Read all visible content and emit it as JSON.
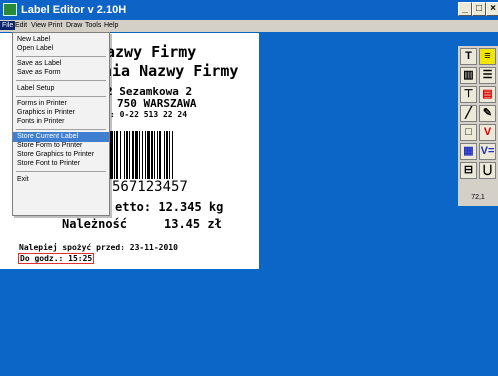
{
  "window": {
    "title": "Label Editor v 2.10H",
    "min": "_",
    "max": "□",
    "close": "×"
  },
  "menubar": [
    "File",
    "Edit",
    "View",
    "Print",
    "Draw",
    "Tools",
    "Help"
  ],
  "file_menu": {
    "groups": [
      [
        "New Label",
        "Open Label"
      ],
      [
        "Save as Label",
        "Save as Form"
      ],
      [
        "Label Setup"
      ],
      [
        "Forms in Printer",
        "Graphics in Printer",
        "Fonts in Printer"
      ],
      [
        "Store Current Label",
        "Store Form to Printer",
        "Store Graphics to Printer",
        "Store Font to Printer"
      ],
      [
        "Exit"
      ]
    ],
    "highlighted": "Store Current Label"
  },
  "label": {
    "line1": "azwy Firmy",
    "line2": "nia Nazwy Firmy",
    "line3": "2 Sezamkowa 2",
    "line4": "750 WARSZAWA",
    "line5": ": 0-22 513 22 24",
    "barcode_text": "567123457",
    "netto": "etto: 12.345 kg",
    "naleznosc_label": "Należność",
    "naleznosc_value": "13.45 zł",
    "best_before": "Nalepiej spożyć przed: 23-11-2010",
    "hour": "Do godz.: 15:25"
  },
  "toolbox": {
    "coordinates": "72,1",
    "tools": [
      "text-tool",
      "text-box-tool",
      "barcode-tool",
      "list-tool",
      "crosshair-tool",
      "printer-tool",
      "line-tool",
      "edit-tool",
      "rectangle-tool",
      "variable-tool",
      "image-tool",
      "variable-equals-tool",
      "form-tool",
      "horseshoe-tool"
    ],
    "colors": {
      "yellow": "#f2e600",
      "red": "#e00000",
      "blue": "#2030c0",
      "cyan": "#00b0d0"
    }
  }
}
